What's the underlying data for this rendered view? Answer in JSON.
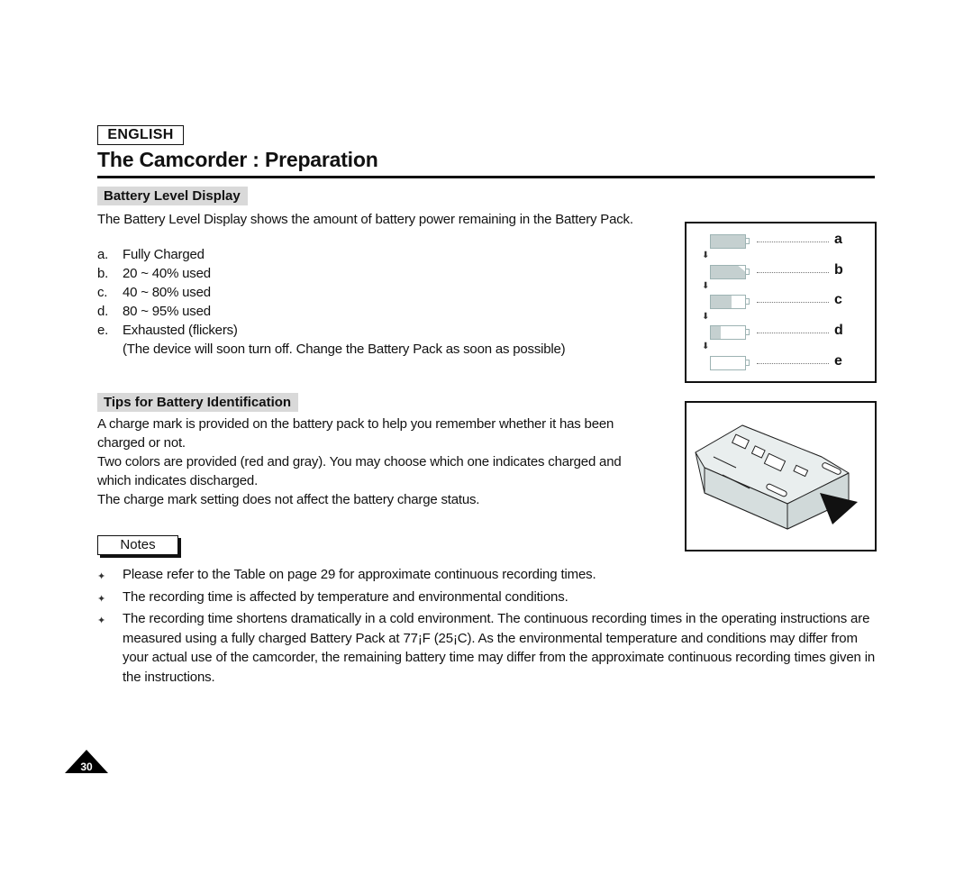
{
  "header": {
    "language_badge": "ENGLISH",
    "title": "The Camcorder : Preparation"
  },
  "battery_level": {
    "heading": "Battery Level Display",
    "intro": "The Battery Level Display shows the amount of battery power remaining in the Battery Pack.",
    "items": [
      {
        "marker": "a.",
        "label": "Fully Charged",
        "letter": "a",
        "remaining_fraction": 1.0
      },
      {
        "marker": "b.",
        "label": "20 ~ 40% used",
        "letter": "b",
        "remaining_fraction": 0.9
      },
      {
        "marker": "c.",
        "label": "40 ~ 80% used",
        "letter": "c",
        "remaining_fraction": 0.6
      },
      {
        "marker": "d.",
        "label": "80 ~ 95% used",
        "letter": "d",
        "remaining_fraction": 0.3
      },
      {
        "marker": "e.",
        "label": "Exhausted (flickers)",
        "letter": "e",
        "remaining_fraction": 0.0
      }
    ],
    "exhausted_note": "(The device will soon turn off. Change the Battery Pack as soon as possible)"
  },
  "tips": {
    "heading": "Tips for Battery Identification",
    "paragraphs": [
      "A charge mark is provided on the battery pack to help you remember whether it has been charged or not.",
      "Two colors are provided (red and gray). You may choose which one indicates charged and which indicates discharged.",
      "The charge mark setting does not affect the battery charge status."
    ]
  },
  "notes": {
    "label": "Notes",
    "items": [
      "Please refer to the Table on page 29 for approximate continuous recording times.",
      "The recording time is affected by temperature and environmental conditions.",
      "The recording time shortens dramatically in a cold environment. The continuous recording times in the operating instructions are measured using a fully charged Battery Pack at 77¡F (25¡C). As the environmental temperature and conditions may differ from your actual use of the camcorder, the remaining battery time may differ from the approximate continuous recording times given in the instructions."
    ]
  },
  "footer": {
    "page_number": "30"
  },
  "colors": {
    "section_heading_bg": "#d9d9d9",
    "battery_fill": "#c5d0d0",
    "battery_outline": "#9db3b3"
  }
}
